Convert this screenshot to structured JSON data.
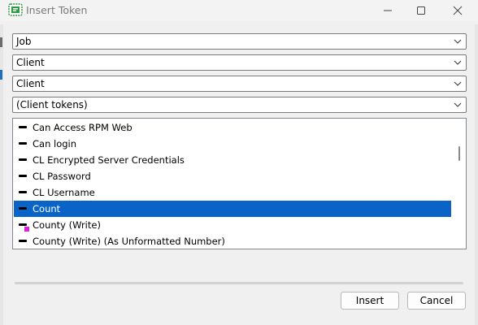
{
  "window": {
    "title": "Insert Token",
    "controls": {
      "minimize": "minimize",
      "maximize": "maximize",
      "close": "close"
    }
  },
  "dropdowns": [
    {
      "value": "Job"
    },
    {
      "value": "Client"
    },
    {
      "value": "Client"
    },
    {
      "value": "(Client tokens)"
    }
  ],
  "token_list": {
    "items": [
      {
        "label": "Can Access RPM Web",
        "selected": false
      },
      {
        "label": "Can login",
        "selected": false
      },
      {
        "label": "CL Encrypted Server Credentials",
        "selected": false
      },
      {
        "label": "CL Password",
        "selected": false
      },
      {
        "label": "CL Username",
        "selected": false
      },
      {
        "label": "Count",
        "selected": true
      },
      {
        "label": "County (Write)",
        "selected": false,
        "marker": "write"
      },
      {
        "label": "County (Write) (As Unformatted Number)",
        "selected": false
      }
    ]
  },
  "buttons": {
    "insert": "Insert",
    "cancel": "Cancel"
  },
  "colors": {
    "selection": "#0a64c8",
    "write_marker": "#e020e0"
  }
}
